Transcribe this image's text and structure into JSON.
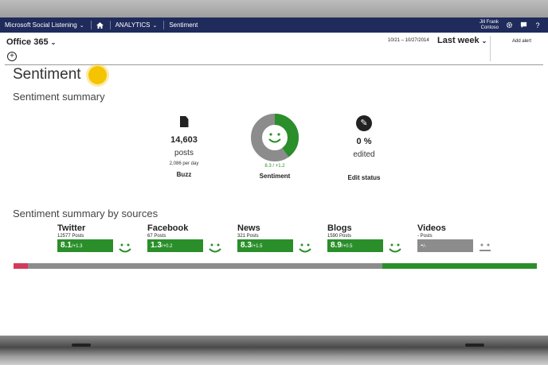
{
  "navbar": {
    "app_title": "Microsoft Social Listening",
    "section": "ANALYTICS",
    "page": "Sentiment",
    "user_name": "Jill Frank",
    "user_org": "Contoso"
  },
  "subbar": {
    "project": "Office 365",
    "date_range": "10/21 – 10/27/2014",
    "period": "Last week",
    "add_alert": "Add alert"
  },
  "page_title": "Sentiment",
  "summary": {
    "heading": "Sentiment summary",
    "buzz": {
      "value": "14,603",
      "unit": "posts",
      "per_day": "2,086 per day",
      "label": "Buzz"
    },
    "sentiment": {
      "score": "8.3 / +1.2",
      "label": "Sentiment",
      "positive_share": 0.4,
      "negative_share": 0.03
    },
    "edit_status": {
      "value": "0 %",
      "unit": "edited",
      "label": "Edit status"
    }
  },
  "sources": {
    "heading": "Sentiment summary by sources",
    "items": [
      {
        "name": "Twitter",
        "posts": "12577 Posts",
        "score": "8.1",
        "delta": "/+1.3",
        "color": "#2a8f2a"
      },
      {
        "name": "Facebook",
        "posts": "67 Posts",
        "score": "1.3",
        "delta": "/+0.2",
        "color": "#2a8f2a"
      },
      {
        "name": "News",
        "posts": "321 Posts",
        "score": "8.3",
        "delta": "/+1.5",
        "color": "#2a8f2a"
      },
      {
        "name": "Blogs",
        "posts": "1590 Posts",
        "score": "8.9",
        "delta": "/+0.5",
        "color": "#2a8f2a"
      },
      {
        "name": "Videos",
        "posts": "- Posts",
        "score": "-",
        "delta": "/-",
        "color": "#8c8c8c"
      }
    ]
  },
  "distribution": {
    "negative": 0.028,
    "neutral": 0.677,
    "positive": 0.295
  },
  "colors": {
    "navbar": "#1f2b5b",
    "positive": "#2a8f2a",
    "negative": "#d23b5a",
    "neutral": "#8c8c8c",
    "highlight": "#f5c400"
  },
  "icons": {
    "home": "home-icon",
    "settings": "gear-icon",
    "chat": "chat-icon",
    "help": "help-icon",
    "buzz": "document-icon",
    "edit": "pencil-icon"
  }
}
